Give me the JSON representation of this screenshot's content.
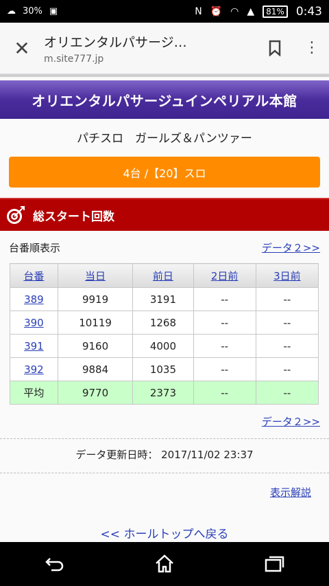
{
  "status": {
    "battery": "81%",
    "time": "0:43",
    "left_text": "30%",
    "nfc": "N"
  },
  "browser": {
    "title": "オリエンタルパサージ…",
    "url": "m.site777.jp"
  },
  "banner": "オリエンタルパサージュインペリアル本館",
  "machine_name": "パチスロ　ガールズ＆パンツァー",
  "count_button": "4台 /【20】スロ",
  "section_title": "総スタート回数",
  "sort_label": "台番順表示",
  "data2_link": "データ２>>",
  "table": {
    "headers": [
      "台番",
      "当日",
      "前日",
      "2日前",
      "3日前"
    ],
    "rows": [
      [
        "389",
        "9919",
        "3191",
        "--",
        "--"
      ],
      [
        "390",
        "10119",
        "1268",
        "--",
        "--"
      ],
      [
        "391",
        "9160",
        "4000",
        "--",
        "--"
      ],
      [
        "392",
        "9884",
        "1035",
        "--",
        "--"
      ]
    ],
    "average": [
      "平均",
      "9770",
      "2373",
      "--",
      "--"
    ]
  },
  "updated": "データ更新日時：  2017/11/02 23:37",
  "help_link": "表示解説",
  "back_link": "<< ホールトップへ戻る",
  "colors": {
    "banner": "#4a2c9c",
    "orange": "#ff8c00",
    "red": "#b30000",
    "average_row": "#c9ffc9",
    "link": "#2a3fb8"
  }
}
